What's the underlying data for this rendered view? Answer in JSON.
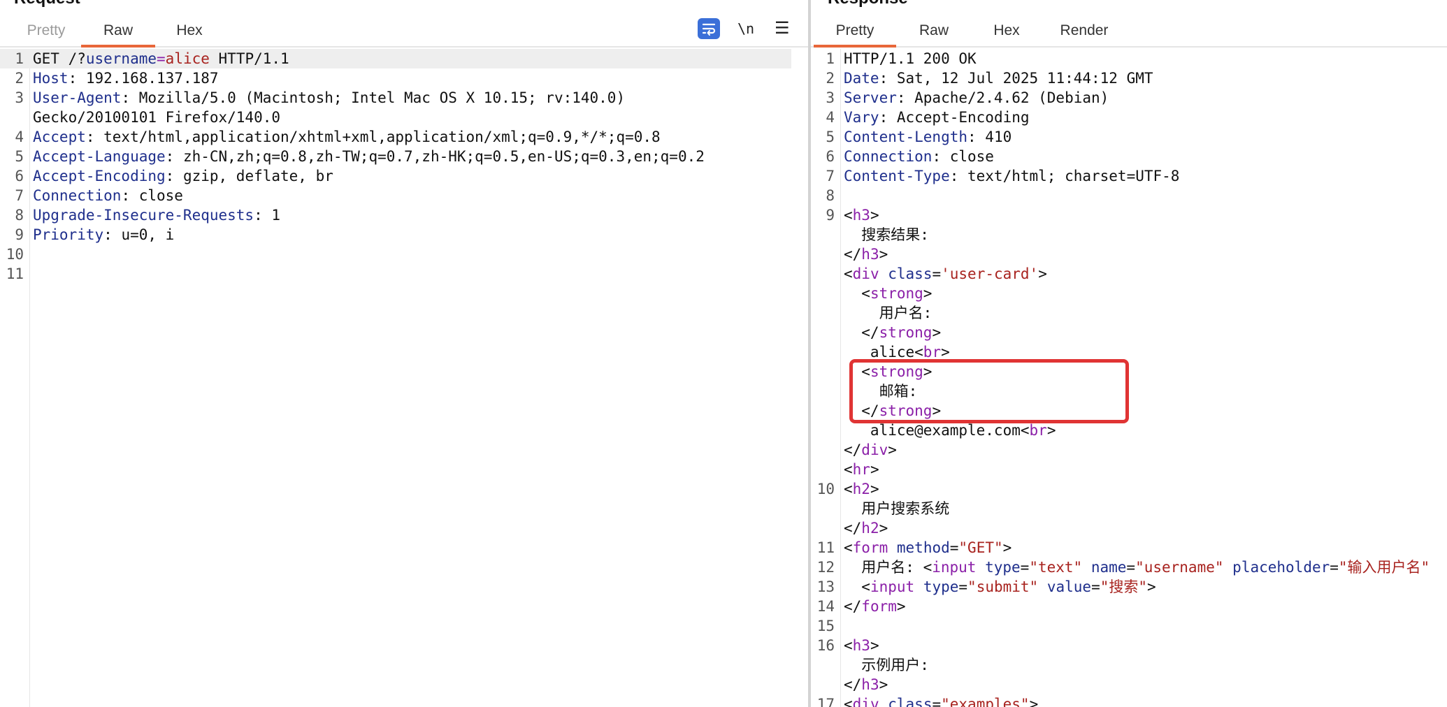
{
  "request": {
    "title": "Request",
    "tabs": [
      {
        "label": "Pretty"
      },
      {
        "label": "Raw"
      },
      {
        "label": "Hex"
      }
    ],
    "newline_label": "\\n",
    "menu_label": "☰",
    "lines": [
      {
        "n": "1",
        "parts": [
          [
            "t",
            "GET /?"
          ],
          [
            "k",
            "username"
          ],
          [
            "o",
            "="
          ],
          [
            "s",
            "alice"
          ],
          [
            "t",
            " HTTP/1.1"
          ]
        ]
      },
      {
        "n": "2",
        "parts": [
          [
            "k",
            "Host"
          ],
          [
            "t",
            ": 192.168.137.187"
          ]
        ]
      },
      {
        "n": "3",
        "parts": [
          [
            "k",
            "User-Agent"
          ],
          [
            "t",
            ": Mozilla/5.0 (Macintosh; Intel Mac OS X 10.15; rv:140.0)"
          ]
        ]
      },
      {
        "n": "",
        "parts": [
          [
            "t",
            "Gecko/20100101 Firefox/140.0"
          ]
        ]
      },
      {
        "n": "4",
        "parts": [
          [
            "k",
            "Accept"
          ],
          [
            "t",
            ": text/html,application/xhtml+xml,application/xml;q=0.9,*/*;q=0.8"
          ]
        ]
      },
      {
        "n": "5",
        "parts": [
          [
            "k",
            "Accept-Language"
          ],
          [
            "t",
            ": zh-CN,zh;q=0.8,zh-TW;q=0.7,zh-HK;q=0.5,en-US;q=0.3,en;q=0.2"
          ]
        ]
      },
      {
        "n": "6",
        "parts": [
          [
            "k",
            "Accept-Encoding"
          ],
          [
            "t",
            ": gzip, deflate, br"
          ]
        ]
      },
      {
        "n": "7",
        "parts": [
          [
            "k",
            "Connection"
          ],
          [
            "t",
            ": close"
          ]
        ]
      },
      {
        "n": "8",
        "parts": [
          [
            "k",
            "Upgrade-Insecure-Requests"
          ],
          [
            "t",
            ": 1"
          ]
        ]
      },
      {
        "n": "9",
        "parts": [
          [
            "k",
            "Priority"
          ],
          [
            "t",
            ": u=0, i"
          ]
        ]
      },
      {
        "n": "10",
        "parts": []
      },
      {
        "n": "11",
        "parts": []
      }
    ]
  },
  "response": {
    "title": "Response",
    "tabs": [
      {
        "label": "Pretty"
      },
      {
        "label": "Raw"
      },
      {
        "label": "Hex"
      },
      {
        "label": "Render"
      }
    ],
    "lines": [
      {
        "n": "1",
        "parts": [
          [
            "t",
            "HTTP/1.1 200 OK"
          ]
        ]
      },
      {
        "n": "2",
        "parts": [
          [
            "k",
            "Date"
          ],
          [
            "t",
            ": Sat, 12 Jul 2025 11:44:12 GMT"
          ]
        ]
      },
      {
        "n": "3",
        "parts": [
          [
            "k",
            "Server"
          ],
          [
            "t",
            ": Apache/2.4.62 (Debian)"
          ]
        ]
      },
      {
        "n": "4",
        "parts": [
          [
            "k",
            "Vary"
          ],
          [
            "t",
            ": Accept-Encoding"
          ]
        ]
      },
      {
        "n": "5",
        "parts": [
          [
            "k",
            "Content-Length"
          ],
          [
            "t",
            ": 410"
          ]
        ]
      },
      {
        "n": "6",
        "parts": [
          [
            "k",
            "Connection"
          ],
          [
            "t",
            ": close"
          ]
        ]
      },
      {
        "n": "7",
        "parts": [
          [
            "k",
            "Content-Type"
          ],
          [
            "t",
            ": text/html; charset=UTF-8"
          ]
        ]
      },
      {
        "n": "8",
        "parts": []
      },
      {
        "n": "9",
        "parts": [
          [
            "t",
            "<"
          ],
          [
            "g",
            "h3"
          ],
          [
            "t",
            ">"
          ]
        ]
      },
      {
        "n": "",
        "parts": [
          [
            "t",
            "  搜索结果:"
          ]
        ]
      },
      {
        "n": "",
        "parts": [
          [
            "t",
            "</"
          ],
          [
            "g",
            "h3"
          ],
          [
            "t",
            ">"
          ]
        ]
      },
      {
        "n": "",
        "parts": [
          [
            "t",
            "<"
          ],
          [
            "g",
            "div"
          ],
          [
            "t",
            " "
          ],
          [
            "a",
            "class"
          ],
          [
            "t",
            "="
          ],
          [
            "s",
            "'user-card'"
          ],
          [
            "t",
            ">"
          ]
        ]
      },
      {
        "n": "",
        "parts": [
          [
            "t",
            "  <"
          ],
          [
            "g",
            "strong"
          ],
          [
            "t",
            ">"
          ]
        ]
      },
      {
        "n": "",
        "parts": [
          [
            "t",
            "    用户名:"
          ]
        ]
      },
      {
        "n": "",
        "parts": [
          [
            "t",
            "  </"
          ],
          [
            "g",
            "strong"
          ],
          [
            "t",
            ">"
          ]
        ]
      },
      {
        "n": "",
        "parts": [
          [
            "t",
            "   alice<"
          ],
          [
            "g",
            "br"
          ],
          [
            "t",
            ">"
          ]
        ]
      },
      {
        "n": "",
        "parts": [
          [
            "t",
            "  <"
          ],
          [
            "g",
            "strong"
          ],
          [
            "t",
            ">"
          ]
        ]
      },
      {
        "n": "",
        "parts": [
          [
            "t",
            "    邮箱:"
          ]
        ]
      },
      {
        "n": "",
        "parts": [
          [
            "t",
            "  </"
          ],
          [
            "g",
            "strong"
          ],
          [
            "t",
            ">"
          ]
        ]
      },
      {
        "n": "",
        "parts": [
          [
            "t",
            "   alice@example.com<"
          ],
          [
            "g",
            "br"
          ],
          [
            "t",
            ">"
          ]
        ]
      },
      {
        "n": "",
        "parts": [
          [
            "t",
            "</"
          ],
          [
            "g",
            "div"
          ],
          [
            "t",
            ">"
          ]
        ]
      },
      {
        "n": "",
        "parts": [
          [
            "t",
            "<"
          ],
          [
            "g",
            "hr"
          ],
          [
            "t",
            ">"
          ]
        ]
      },
      {
        "n": "10",
        "parts": [
          [
            "t",
            "<"
          ],
          [
            "g",
            "h2"
          ],
          [
            "t",
            ">"
          ]
        ]
      },
      {
        "n": "",
        "parts": [
          [
            "t",
            "  用户搜索系统"
          ]
        ]
      },
      {
        "n": "",
        "parts": [
          [
            "t",
            "</"
          ],
          [
            "g",
            "h2"
          ],
          [
            "t",
            ">"
          ]
        ]
      },
      {
        "n": "11",
        "parts": [
          [
            "t",
            "<"
          ],
          [
            "g",
            "form"
          ],
          [
            "t",
            " "
          ],
          [
            "a",
            "method"
          ],
          [
            "t",
            "="
          ],
          [
            "s",
            "\"GET\""
          ],
          [
            "t",
            ">"
          ]
        ]
      },
      {
        "n": "12",
        "parts": [
          [
            "t",
            "  用户名: <"
          ],
          [
            "g",
            "input"
          ],
          [
            "t",
            " "
          ],
          [
            "a",
            "type"
          ],
          [
            "t",
            "="
          ],
          [
            "s",
            "\"text\""
          ],
          [
            "t",
            " "
          ],
          [
            "a",
            "name"
          ],
          [
            "t",
            "="
          ],
          [
            "s",
            "\"username\""
          ],
          [
            "t",
            " "
          ],
          [
            "a",
            "placeholder"
          ],
          [
            "t",
            "="
          ],
          [
            "s",
            "\"输入用户名\""
          ]
        ]
      },
      {
        "n": "13",
        "parts": [
          [
            "t",
            "  <"
          ],
          [
            "g",
            "input"
          ],
          [
            "t",
            " "
          ],
          [
            "a",
            "type"
          ],
          [
            "t",
            "="
          ],
          [
            "s",
            "\"submit\""
          ],
          [
            "t",
            " "
          ],
          [
            "a",
            "value"
          ],
          [
            "t",
            "="
          ],
          [
            "s",
            "\"搜索\""
          ],
          [
            "t",
            ">"
          ]
        ]
      },
      {
        "n": "14",
        "parts": [
          [
            "t",
            "</"
          ],
          [
            "g",
            "form"
          ],
          [
            "t",
            ">"
          ]
        ]
      },
      {
        "n": "15",
        "parts": []
      },
      {
        "n": "16",
        "parts": [
          [
            "t",
            "<"
          ],
          [
            "g",
            "h3"
          ],
          [
            "t",
            ">"
          ]
        ]
      },
      {
        "n": "",
        "parts": [
          [
            "t",
            "  示例用户:"
          ]
        ]
      },
      {
        "n": "",
        "parts": [
          [
            "t",
            "</"
          ],
          [
            "g",
            "h3"
          ],
          [
            "t",
            ">"
          ]
        ]
      },
      {
        "n": "17",
        "parts": [
          [
            "t",
            "<"
          ],
          [
            "g",
            "div"
          ],
          [
            "t",
            " "
          ],
          [
            "a",
            "class"
          ],
          [
            "t",
            "="
          ],
          [
            "s",
            "\"examples\""
          ],
          [
            "t",
            ">"
          ]
        ]
      }
    ]
  },
  "colors": {
    "accent_tab": "#e8673a",
    "header_key": "#1f2f8c",
    "tag": "#8b20a8",
    "string": "#a8231f",
    "highlight_box": "#e03434",
    "wrap_button": "#3b6fd8"
  },
  "icons": {
    "wrap": "word-wrap-icon",
    "menu": "hamburger-menu-icon"
  }
}
